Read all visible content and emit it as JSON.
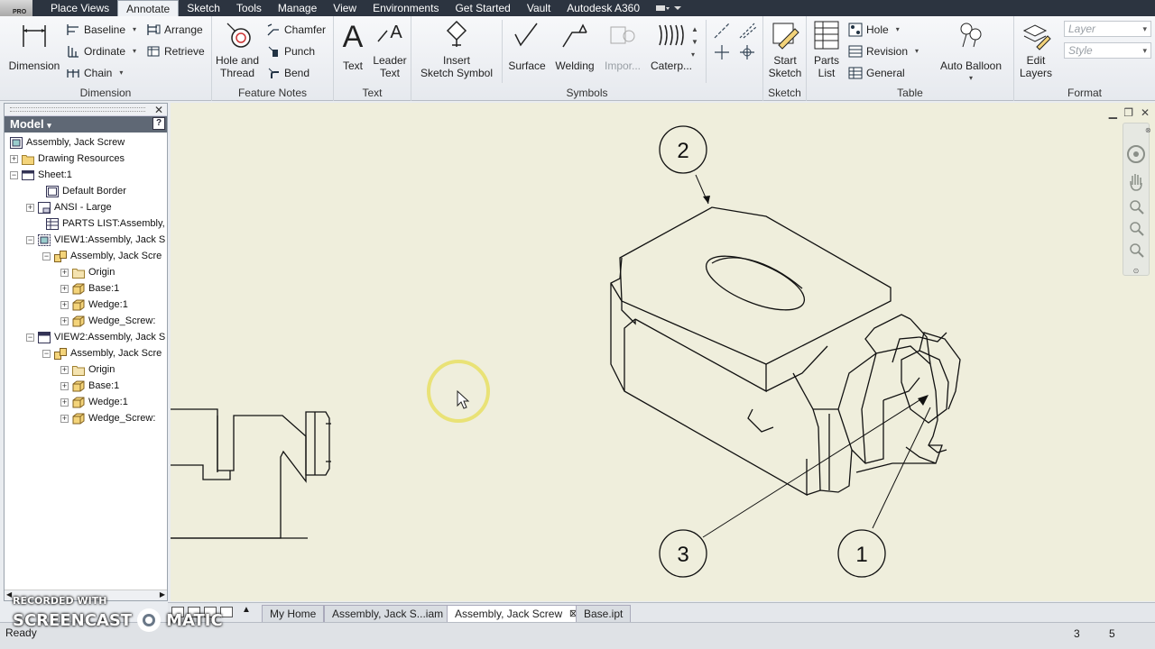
{
  "app": {
    "logo_text": "PRO"
  },
  "menu_tabs": [
    "Place Views",
    "Annotate",
    "Sketch",
    "Tools",
    "Manage",
    "View",
    "Environments",
    "Get Started",
    "Vault",
    "Autodesk A360"
  ],
  "ribbon": {
    "dimension": {
      "title": "Dimension",
      "big_label": "Dimension",
      "baseline": "Baseline",
      "ordinate": "Ordinate",
      "chain": "Chain",
      "arrange": "Arrange",
      "retrieve": "Retrieve"
    },
    "feature_notes": {
      "title": "Feature Notes",
      "hole_thread_1": "Hole and",
      "hole_thread_2": "Thread",
      "chamfer": "Chamfer",
      "punch": "Punch",
      "bend": "Bend"
    },
    "text": {
      "title": "Text",
      "text_label": "Text",
      "leader_1": "Leader",
      "leader_2": "Text"
    },
    "symbols": {
      "title": "Symbols",
      "insert_1": "Insert",
      "insert_2": "Sketch Symbol",
      "surface": "Surface",
      "welding": "Welding",
      "import": "Impor...",
      "caterpillar": "Caterp..."
    },
    "sketch": {
      "title": "Sketch",
      "start_1": "Start",
      "start_2": "Sketch"
    },
    "table": {
      "title": "Table",
      "parts_1": "Parts",
      "parts_2": "List",
      "hole": "Hole",
      "revision": "Revision",
      "general": "General",
      "auto_balloon": "Auto Balloon"
    },
    "format": {
      "title": "Format",
      "edit_1": "Edit",
      "edit_2": "Layers",
      "layer_placeholder": "Layer",
      "style_placeholder": "Style"
    }
  },
  "browser": {
    "header": "Model",
    "help": "?",
    "items": [
      {
        "label": "Assembly, Jack Screw"
      },
      {
        "label": "Drawing Resources"
      },
      {
        "label": "Sheet:1"
      },
      {
        "label": "Default Border"
      },
      {
        "label": "ANSI - Large"
      },
      {
        "label": "PARTS LIST:Assembly, ,"
      },
      {
        "label": "VIEW1:Assembly, Jack S"
      },
      {
        "label": "Assembly, Jack Scre"
      },
      {
        "label": "Origin"
      },
      {
        "label": "Base:1"
      },
      {
        "label": "Wedge:1"
      },
      {
        "label": "Wedge_Screw:"
      },
      {
        "label": "VIEW2:Assembly, Jack S"
      },
      {
        "label": "Assembly, Jack Scre"
      },
      {
        "label": "Origin"
      },
      {
        "label": "Base:1"
      },
      {
        "label": "Wedge:1"
      },
      {
        "label": "Wedge_Screw:"
      }
    ]
  },
  "drawing": {
    "balloons": [
      "2",
      "3",
      "1"
    ]
  },
  "doc_tabs": [
    "My Home",
    "Assembly, Jack S...iam",
    "Assembly, Jack Screw",
    "Base.ipt"
  ],
  "status": {
    "text": "Ready",
    "num1": "3",
    "num2": "5"
  },
  "watermark": {
    "line1": "RECORDED WITH",
    "line2": "SCREENCAST",
    "line3": "MATIC"
  }
}
